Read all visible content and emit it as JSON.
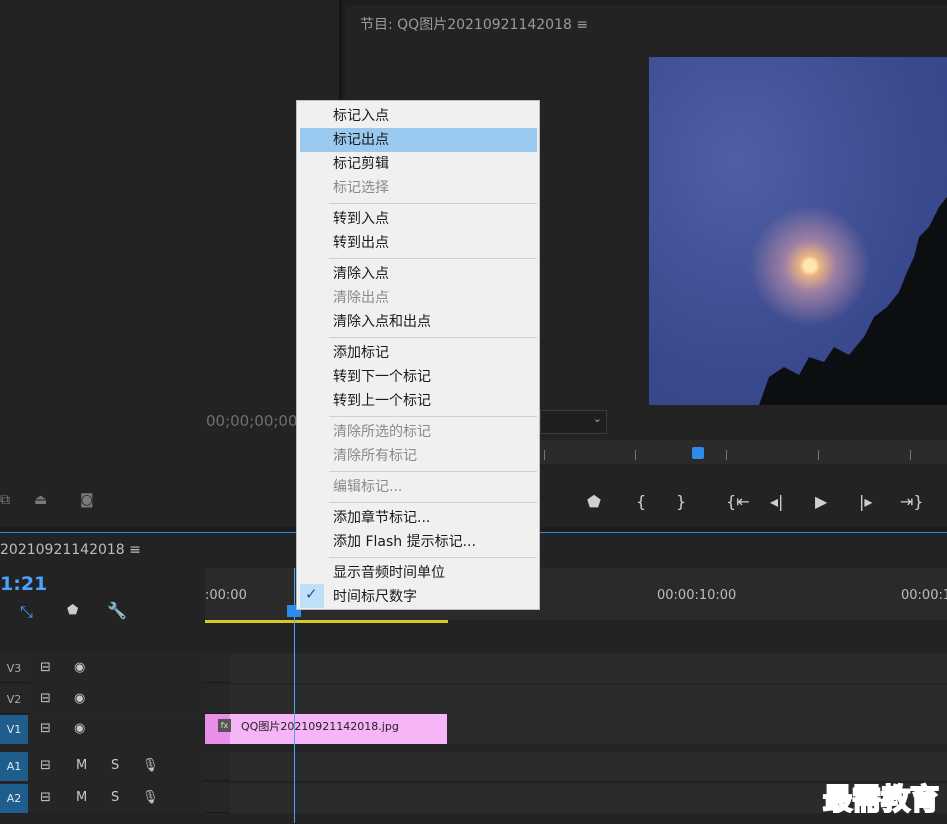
{
  "source_monitor": {
    "timecode": "00;00;00;00"
  },
  "program_monitor": {
    "title": "节目: QQ图片20210921142018 ≡"
  },
  "timeline": {
    "sequence_tab": "20210921142018 ≡",
    "timecode": "1:21",
    "ruler_labels": [
      ":00:00",
      "00:00:10:00",
      "00:00:1"
    ],
    "tracks": [
      {
        "label": "V3"
      },
      {
        "label": "V2"
      },
      {
        "label": "V1"
      },
      {
        "label": "A1",
        "m": "M",
        "s": "S"
      },
      {
        "label": "A2",
        "m": "M",
        "s": "S"
      }
    ],
    "clip_name": "QQ图片20210921142018.jpg",
    "clip_fx": "fx"
  },
  "context_menu": {
    "items": [
      {
        "label": "标记入点",
        "enabled": true
      },
      {
        "label": "标记出点",
        "enabled": true,
        "highlighted": true
      },
      {
        "label": "标记剪辑",
        "enabled": true
      },
      {
        "label": "标记选择",
        "enabled": false
      },
      {
        "label": "转到入点",
        "enabled": true
      },
      {
        "label": "转到出点",
        "enabled": true
      },
      {
        "label": "清除入点",
        "enabled": true
      },
      {
        "label": "清除出点",
        "enabled": false
      },
      {
        "label": "清除入点和出点",
        "enabled": true
      },
      {
        "label": "添加标记",
        "enabled": true
      },
      {
        "label": "转到下一个标记",
        "enabled": true
      },
      {
        "label": "转到上一个标记",
        "enabled": true
      },
      {
        "label": "清除所选的标记",
        "enabled": false
      },
      {
        "label": "清除所有标记",
        "enabled": false
      },
      {
        "label": "编辑标记...",
        "enabled": false
      },
      {
        "label": "添加章节标记...",
        "enabled": true
      },
      {
        "label": "添加 Flash 提示标记...",
        "enabled": true
      },
      {
        "label": "显示音频时间单位",
        "enabled": true
      },
      {
        "label": "时间标尺数字",
        "enabled": true,
        "checked": true
      }
    ]
  },
  "watermark": "最需教育"
}
